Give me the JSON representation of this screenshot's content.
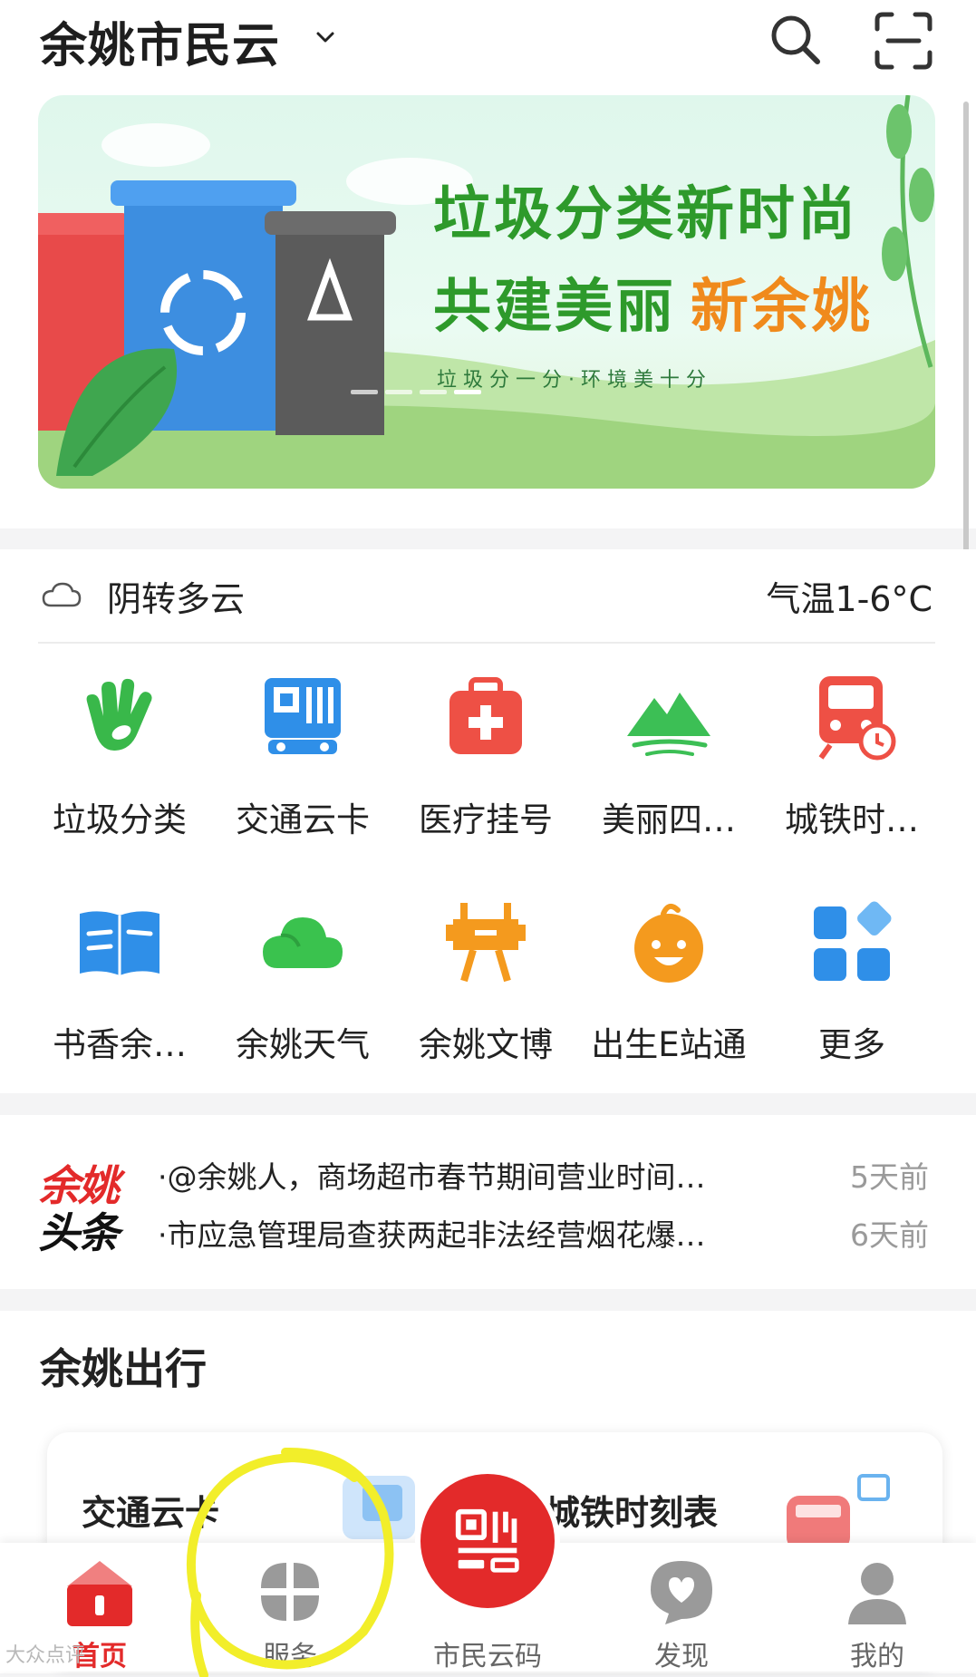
{
  "header": {
    "city": "余姚市民云",
    "icons": [
      "chevron-down-icon",
      "search-icon",
      "scan-icon"
    ]
  },
  "banner": {
    "headline": "垃圾分类新时尚",
    "subline_a": "共建美丽",
    "subline_b": "新余姚",
    "tagline": "垃 圾 分 一 分 · 环 境 美 十 分",
    "page_indicator": {
      "pages": 4,
      "active": 4
    },
    "colors": {
      "green": "#2e9a2b",
      "orange": "#f08a1c"
    }
  },
  "weather": {
    "condition": "阴转多云",
    "temperature": "气温1-6°C",
    "icon": "cloud-icon"
  },
  "services": [
    {
      "label": "垃圾分类",
      "icon": "hand-leaf-icon",
      "color": "#39b84a"
    },
    {
      "label": "交通云卡",
      "icon": "transit-card-icon",
      "color": "#2f8fe8"
    },
    {
      "label": "医疗挂号",
      "icon": "medical-kit-icon",
      "color": "#ee5045"
    },
    {
      "label": "美丽四…",
      "icon": "mountain-icon",
      "color": "#3cbf55"
    },
    {
      "label": "城铁时…",
      "icon": "train-clock-icon",
      "color": "#ee5045"
    },
    {
      "label": "书香余…",
      "icon": "book-icon",
      "color": "#2f8fe8"
    },
    {
      "label": "余姚天气",
      "icon": "weather-cloud-icon",
      "color": "#3ac24e"
    },
    {
      "label": "余姚文博",
      "icon": "museum-icon",
      "color": "#f49a1e"
    },
    {
      "label": "出生E站通",
      "icon": "baby-icon",
      "color": "#f49a1e"
    },
    {
      "label": "更多",
      "icon": "more-grid-icon",
      "color": "#2f8fe8"
    }
  ],
  "news": {
    "logo_top": "余姚",
    "logo_bottom": "头条",
    "items": [
      {
        "title": "·@余姚人，商场超市春节期间营业时间…",
        "time": "5天前"
      },
      {
        "title": "·市应急管理局查获两起非法经营烟花爆…",
        "time": "6天前"
      }
    ]
  },
  "travel": {
    "title": "余姚出行",
    "card_a": "交通云卡",
    "card_b": "城铁时刻表"
  },
  "bottom_nav": [
    {
      "label": "首页",
      "icon": "home-icon",
      "active": true
    },
    {
      "label": "服务",
      "icon": "services-icon",
      "active": false
    },
    {
      "label": "市民云码",
      "icon": "qr-code-icon",
      "active": false
    },
    {
      "label": "发现",
      "icon": "discover-icon",
      "active": false
    },
    {
      "label": "我的",
      "icon": "profile-icon",
      "active": false
    }
  ],
  "nav_colors": {
    "active": "#e32a2a",
    "inactive": "#9a9a9a"
  },
  "watermark": "大众点评"
}
